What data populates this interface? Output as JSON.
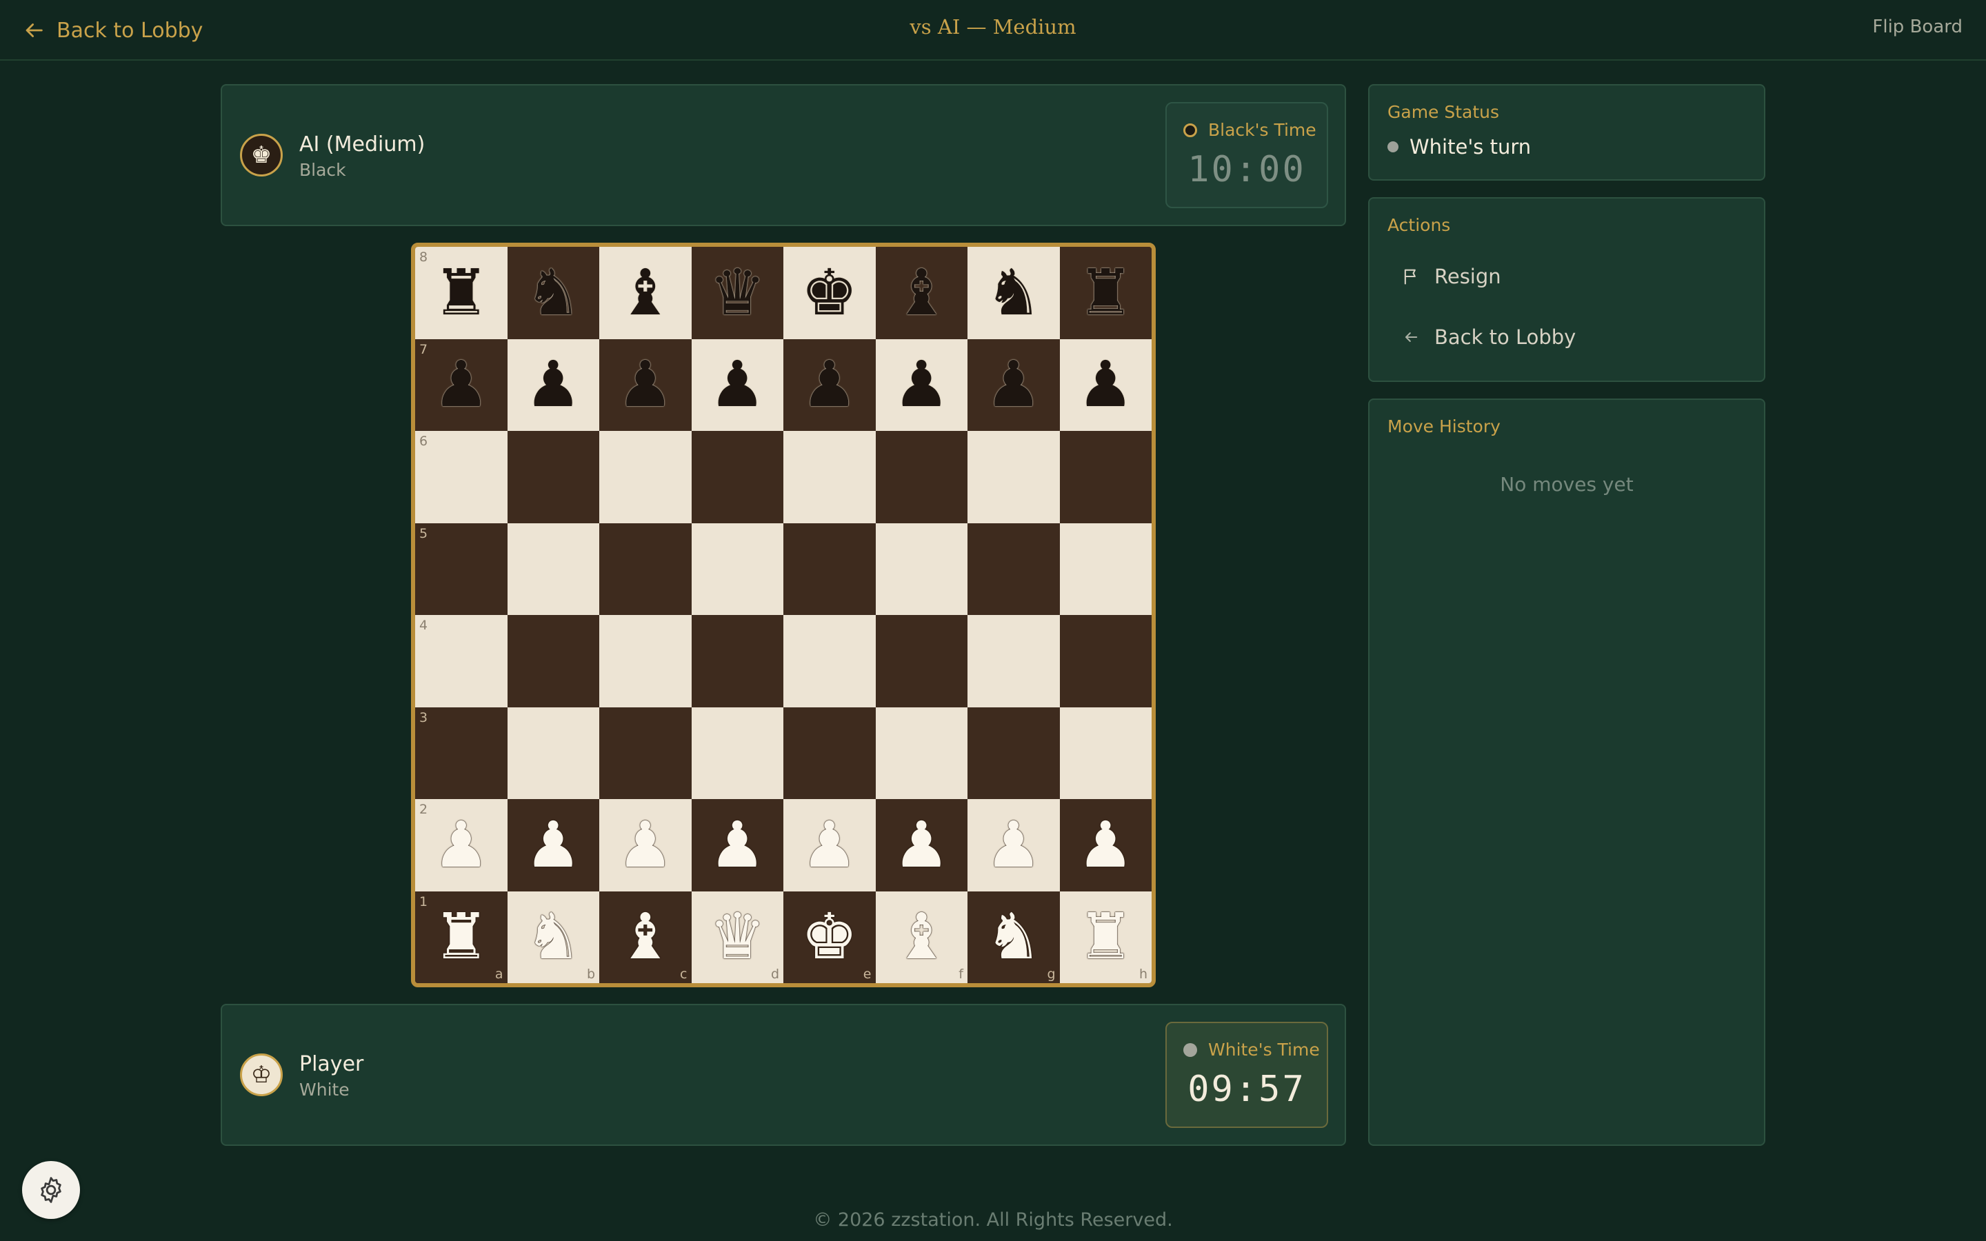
{
  "header": {
    "back_label": "Back to Lobby",
    "title": "vs AI — Medium",
    "flip_label": "Flip Board"
  },
  "opponent": {
    "name": "AI (Medium)",
    "color": "Black",
    "avatar_glyph": "♚",
    "timer_label": "Black's Time",
    "timer_value": "10:00"
  },
  "player": {
    "name": "Player",
    "color": "White",
    "avatar_glyph": "♔",
    "timer_label": "White's Time",
    "timer_value": "09:57"
  },
  "board": {
    "rows": [
      [
        "bR",
        "bN",
        "bB",
        "bQ",
        "bK",
        "bB",
        "bN",
        "bR"
      ],
      [
        "bP",
        "bP",
        "bP",
        "bP",
        "bP",
        "bP",
        "bP",
        "bP"
      ],
      [
        "",
        "",
        "",
        "",
        "",
        "",
        "",
        ""
      ],
      [
        "",
        "",
        "",
        "",
        "",
        "",
        "",
        ""
      ],
      [
        "",
        "",
        "",
        "",
        "",
        "",
        "",
        ""
      ],
      [
        "",
        "",
        "",
        "",
        "",
        "",
        "",
        ""
      ],
      [
        "wP",
        "wP",
        "wP",
        "wP",
        "wP",
        "wP",
        "wP",
        "wP"
      ],
      [
        "wR",
        "wN",
        "wB",
        "wQ",
        "wK",
        "wB",
        "wN",
        "wR"
      ]
    ],
    "ranks": [
      "8",
      "7",
      "6",
      "5",
      "4",
      "3",
      "2",
      "1"
    ],
    "files": [
      "a",
      "b",
      "c",
      "d",
      "e",
      "f",
      "g",
      "h"
    ],
    "light_color": "#ede4d4",
    "dark_color": "#3e2b1e"
  },
  "status": {
    "title": "Game Status",
    "text": "White's turn"
  },
  "actions": {
    "title": "Actions",
    "resign": "Resign",
    "back": "Back to Lobby"
  },
  "history": {
    "title": "Move History",
    "empty": "No moves yet"
  },
  "footer": {
    "copyright": "© 2026 zzstation. All Rights Reserved."
  },
  "colors": {
    "background": "#11271f",
    "panel": "#1b3a2e",
    "accent_gold": "#c9a24a"
  }
}
